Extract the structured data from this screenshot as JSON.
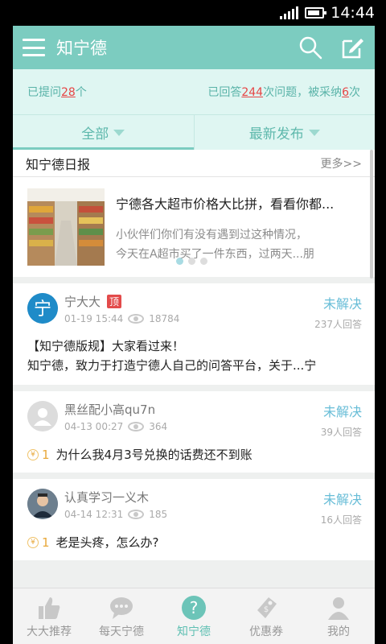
{
  "status_bar": {
    "time": "14:44"
  },
  "header": {
    "title": "知宁德"
  },
  "stats": {
    "asked_prefix": "已提问",
    "asked_num": "28",
    "asked_suffix": "个",
    "answered_prefix": "已回答",
    "answered_num": "244",
    "answered_mid": "次问题，被采纳",
    "adopted_num": "6",
    "adopted_suffix": "次"
  },
  "filter_tabs": [
    {
      "label": "全部"
    },
    {
      "label": "最新发布"
    }
  ],
  "daily": {
    "title": "知宁德日报",
    "more": "更多>>",
    "article_title": "宁德各大超市价格大比拼，看看你都...",
    "article_line1": "小伙伴们你们有没有遇到过这种情况，",
    "article_line2": "今天在A超市买了一件东西，过两天...朋"
  },
  "posts": [
    {
      "user": "宁大大",
      "badge": "顶",
      "time": "01-19 15:44",
      "views": "18784",
      "status": "未解决",
      "answers": "237人回答",
      "title": "【知宁德版规】大家看过来！",
      "excerpt": "知宁德，致力于打造宁德人自己的问答平台，关于...宁"
    },
    {
      "user": "黑丝配小高qu7n",
      "time": "04-13 00:27",
      "views": "364",
      "status": "未解决",
      "answers": "39人回答",
      "reward": "1",
      "question": "为什么我4月3号兑换的话费还不到账"
    },
    {
      "user": "认真学习一义木",
      "time": "04-14 12:31",
      "views": "185",
      "status": "未解决",
      "answers": "16人回答",
      "reward": "1",
      "question": "老是头疼，怎么办?"
    }
  ],
  "bottom_tabs": [
    {
      "label": "大大推荐",
      "icon": "thumbs-up-icon"
    },
    {
      "label": "每天宁德",
      "icon": "chat-bubble-icon"
    },
    {
      "label": "知宁德",
      "icon": "question-icon"
    },
    {
      "label": "优惠券",
      "icon": "coupon-icon"
    },
    {
      "label": "我的",
      "icon": "user-icon"
    }
  ],
  "colors": {
    "accent": "#7cccc0",
    "light_bg": "#dff6f2",
    "highlight": "#e64545",
    "status_blue": "#68bdd7"
  }
}
